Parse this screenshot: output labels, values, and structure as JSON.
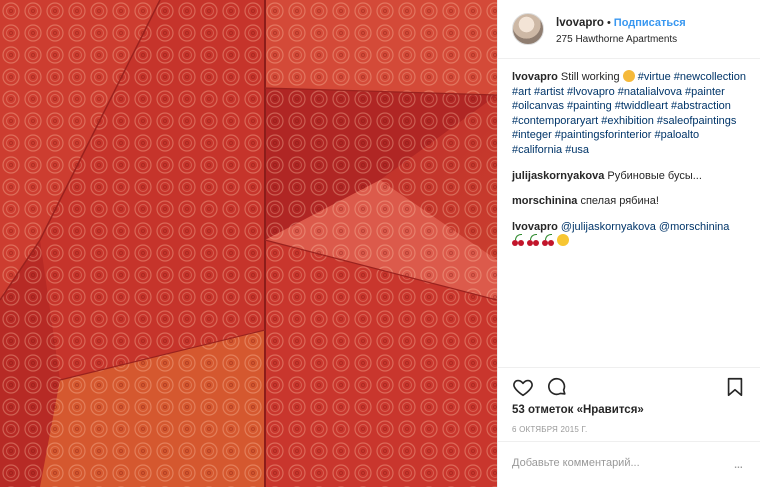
{
  "post": {
    "author": "lvovapro",
    "separator": "•",
    "follow_label": "Подписаться",
    "location": "275 Hawthorne Apartments",
    "avatar_alt": "avatar",
    "image_description": "red textured painting with swirl pattern"
  },
  "caption": {
    "user": "lvovapro",
    "text": "Still working",
    "hashtags": "#virtue #newcollection #art #artist #lvovapro #natalialvova #painter #oilcanvas #painting #twiddleart #abstraction #contemporaryart #exhibition #saleofpaintings #integer #paintingsforinterior #paloalto #california #usa"
  },
  "comments": [
    {
      "user": "julijaskornyakova",
      "text": "Рубиновые бусы..."
    },
    {
      "user": "morschinina",
      "text": "спелая рябина!"
    },
    {
      "user": "lvovapro",
      "mentions": "@julijaskornyakova @morschinina"
    }
  ],
  "actions": {
    "like_icon": "heart-icon",
    "comment_icon": "comment-icon",
    "save_icon": "bookmark-icon"
  },
  "likes": "53 отметок «Нравится»",
  "date": "6 ОКТЯБРЯ 2015 Г.",
  "comment_box": {
    "placeholder": "Добавьте комментарий...",
    "more": "..."
  },
  "colors": {
    "link": "#3897f0",
    "hashtag": "#003569",
    "painting": "#c8362b"
  }
}
